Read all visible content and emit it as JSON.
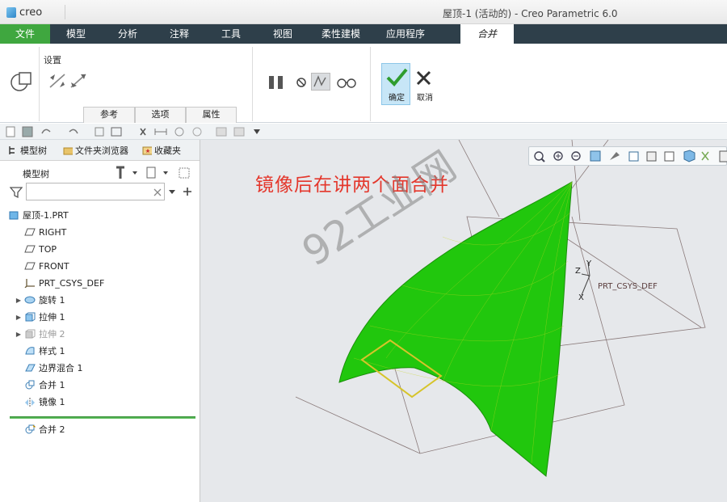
{
  "app": {
    "logo": "creo",
    "window_title": "屋顶-1 (活动的) - Creo Parametric 6.0"
  },
  "ribbon": {
    "tabs": [
      "文件",
      "模型",
      "分析",
      "注释",
      "工具",
      "视图",
      "柔性建模",
      "应用程序"
    ],
    "active_tab": "合并",
    "settings_label": "设置",
    "subtabs": [
      "参考",
      "选项",
      "属性"
    ],
    "ok_label": "确定",
    "cancel_label": "取消"
  },
  "panel": {
    "tabs": [
      "模型树",
      "文件夹浏览器",
      "收藏夹"
    ],
    "tree_header": "模型树",
    "filter_placeholder": "",
    "items": [
      {
        "label": "屋顶-1.PRT",
        "icon": "part-icon",
        "expandable": false,
        "dim": false
      },
      {
        "label": "RIGHT",
        "icon": "datum-plane-icon",
        "expandable": false,
        "dim": false
      },
      {
        "label": "TOP",
        "icon": "datum-plane-icon",
        "expandable": false,
        "dim": false
      },
      {
        "label": "FRONT",
        "icon": "datum-plane-icon",
        "expandable": false,
        "dim": false
      },
      {
        "label": "PRT_CSYS_DEF",
        "icon": "csys-icon",
        "expandable": false,
        "dim": false
      },
      {
        "label": "旋转 1",
        "icon": "revolve-icon",
        "expandable": true,
        "dim": false
      },
      {
        "label": "拉伸 1",
        "icon": "extrude-icon",
        "expandable": true,
        "dim": false
      },
      {
        "label": "拉伸 2",
        "icon": "extrude-icon",
        "expandable": true,
        "dim": true
      },
      {
        "label": "样式 1",
        "icon": "style-icon",
        "expandable": false,
        "dim": false
      },
      {
        "label": "边界混合 1",
        "icon": "boundary-blend-icon",
        "expandable": false,
        "dim": false
      },
      {
        "label": "合并 1",
        "icon": "merge-icon",
        "expandable": false,
        "dim": false
      },
      {
        "label": "镜像 1",
        "icon": "mirror-icon",
        "expandable": false,
        "dim": false
      }
    ],
    "inserting_item": {
      "label": "合并 2",
      "icon": "merge-icon"
    }
  },
  "viewport": {
    "annotation": "镜像后在讲两个面合并",
    "watermark": "92工业网",
    "csys_label": "PRT_CSYS_DEF",
    "axis_labels": [
      "Y",
      "Z",
      "X"
    ]
  },
  "colors": {
    "tab_bar": "#2e3f4a",
    "file_tab": "#3fa73f",
    "surface": "#22c70c",
    "annotation": "#e4372c"
  }
}
